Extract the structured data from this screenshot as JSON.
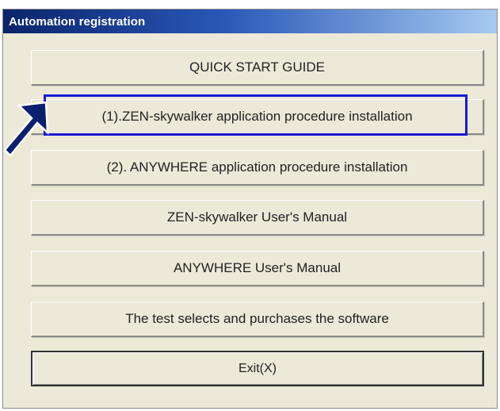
{
  "window": {
    "title": "Automation registration"
  },
  "buttons": {
    "quick_start": "QUICK START GUIDE",
    "zen_install": "(1).ZEN-skywalker application procedure installation",
    "anywhere_install": "(2). ANYWHERE application procedure installation",
    "zen_manual": "ZEN-skywalker User's Manual",
    "anywhere_manual": "ANYWHERE User's Manual",
    "test_purchase": "The test selects and purchases the software",
    "exit": "Exit(X)"
  },
  "annotation": {
    "highlight_color": "#1a1ad6",
    "arrow_color": "#0a1f6e",
    "arrow_icon": "pointer-arrow-icon"
  },
  "colors": {
    "titlebar_start": "#0a246a",
    "titlebar_end": "#a6caf0",
    "window_bg": "#ece9d8"
  }
}
